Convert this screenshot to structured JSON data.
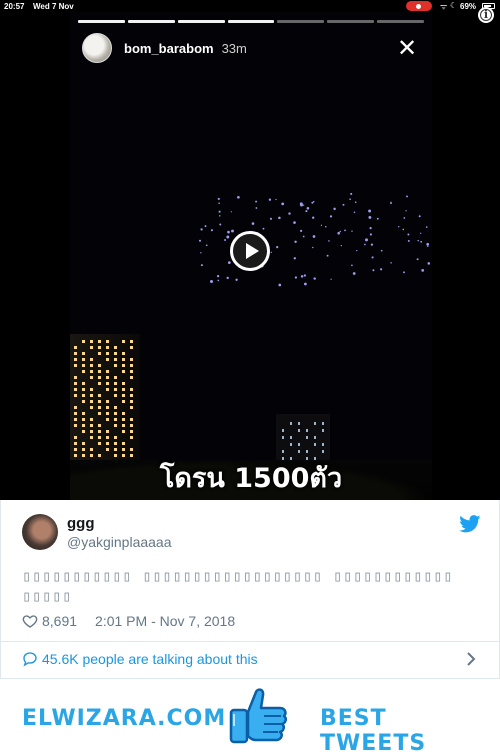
{
  "status_bar": {
    "time": "20:57",
    "date": "Wed 7 Nov",
    "battery": "69%"
  },
  "story": {
    "username": "bom_barabom",
    "age": "33m",
    "caption": "โดรน 1500ตัว",
    "progress_segments_total": 7,
    "progress_segments_done": 4
  },
  "tweet": {
    "name": "ggg",
    "handle": "@yakginplaaaaa",
    "text": "▯▯▯▯▯▯▯▯▯▯▯ ▯▯▯▯▯▯▯▯▯▯▯▯▯▯▯▯▯▯ ▯▯▯▯▯▯▯▯▯▯▯▯ ▯▯▯▯▯",
    "likes": "8,691",
    "timestamp": "2:01 PM - Nov 7, 2018",
    "talking": "45.6K people are talking about this",
    "accent_color": "#1b95e0"
  },
  "banner": {
    "site": "ELWIZARA.COM",
    "label": "BEST TWEETS",
    "color": "#2aa6e6"
  }
}
